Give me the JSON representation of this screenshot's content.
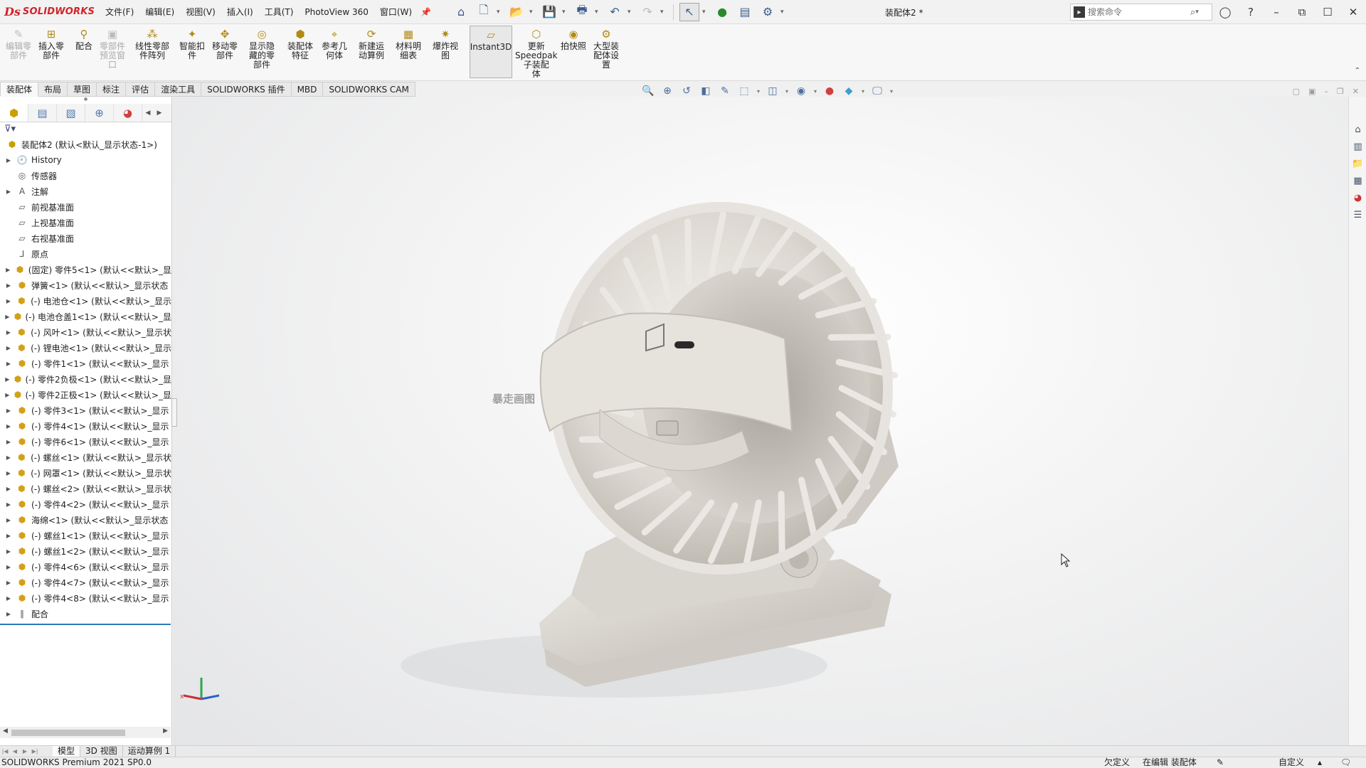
{
  "app": {
    "brand_mark": "Ds",
    "brand_text": "SOLIDWORKS",
    "doc_title": "装配体2 *"
  },
  "menu": [
    "文件(F)",
    "编辑(E)",
    "视图(V)",
    "插入(I)",
    "工具(T)",
    "PhotoView 360",
    "窗口(W)"
  ],
  "search": {
    "placeholder": "搜索命令"
  },
  "commands": [
    {
      "label": "编辑零\n部件",
      "icon": "edit-component-icon",
      "disabled": true
    },
    {
      "label": "插入零\n部件",
      "icon": "insert-component-icon"
    },
    {
      "label": "配合",
      "icon": "mate-icon"
    },
    {
      "label": "零部件\n预览窗\n口",
      "icon": "preview-window-icon",
      "disabled": true
    },
    {
      "label": "线性零部\n件阵列",
      "icon": "linear-pattern-icon"
    },
    {
      "label": "智能扣\n件",
      "icon": "smart-fastener-icon"
    },
    {
      "label": "移动零\n部件",
      "icon": "move-component-icon"
    },
    {
      "label": "显示隐\n藏的零\n部件",
      "icon": "show-hidden-icon"
    },
    {
      "label": "装配体\n特征",
      "icon": "assembly-feature-icon"
    },
    {
      "label": "参考几\n何体",
      "icon": "reference-geometry-icon"
    },
    {
      "label": "新建运\n动算例",
      "icon": "motion-study-icon"
    },
    {
      "label": "材料明\n细表",
      "icon": "bom-icon"
    },
    {
      "label": "爆炸视\n图",
      "icon": "exploded-view-icon"
    },
    {
      "label": "Instant3D",
      "icon": "instant3d-icon",
      "selected": true
    },
    {
      "label": "更新\nSpeedpak\n子装配\n体",
      "icon": "speedpak-icon"
    },
    {
      "label": "拍快照",
      "icon": "snapshot-icon"
    },
    {
      "label": "大型装\n配体设\n置",
      "icon": "large-assembly-icon"
    }
  ],
  "tabs": [
    "装配体",
    "布局",
    "草图",
    "标注",
    "评估",
    "渲染工具",
    "SOLIDWORKS 插件",
    "MBD",
    "SOLIDWORKS CAM"
  ],
  "tree": {
    "root": "装配体2  (默认<默认_显示状态-1>)",
    "items": [
      {
        "label": "History",
        "icon": "history-icon",
        "expand": true
      },
      {
        "label": "传感器",
        "icon": "sensors-icon",
        "expand": false
      },
      {
        "label": "注解",
        "icon": "annotations-icon",
        "expand": true
      },
      {
        "label": "前视基准面",
        "icon": "plane-icon",
        "expand": false
      },
      {
        "label": "上视基准面",
        "icon": "plane-icon",
        "expand": false
      },
      {
        "label": "右视基准面",
        "icon": "plane-icon",
        "expand": false
      },
      {
        "label": "原点",
        "icon": "origin-icon",
        "expand": false
      },
      {
        "label": "(固定) 零件5<1> (默认<<默认>_显",
        "icon": "part-icon",
        "expand": true
      },
      {
        "label": "弹簧<1> (默认<<默认>_显示状态",
        "icon": "part-icon",
        "expand": true
      },
      {
        "label": "(-) 电池仓<1> (默认<<默认>_显示",
        "icon": "part-icon",
        "expand": true
      },
      {
        "label": "(-) 电池仓盖1<1> (默认<<默认>_显",
        "icon": "part-icon",
        "expand": true
      },
      {
        "label": "(-) 风叶<1> (默认<<默认>_显示状",
        "icon": "part-icon",
        "expand": true
      },
      {
        "label": "(-) 锂电池<1> (默认<<默认>_显示",
        "icon": "part-icon",
        "expand": true
      },
      {
        "label": "(-) 零件1<1> (默认<<默认>_显示",
        "icon": "part-icon",
        "expand": true
      },
      {
        "label": "(-) 零件2负极<1> (默认<<默认>_显",
        "icon": "part-icon",
        "expand": true
      },
      {
        "label": "(-) 零件2正极<1> (默认<<默认>_显",
        "icon": "part-icon",
        "expand": true
      },
      {
        "label": "(-) 零件3<1> (默认<<默认>_显示",
        "icon": "part-icon",
        "expand": true
      },
      {
        "label": "(-) 零件4<1> (默认<<默认>_显示",
        "icon": "part-icon",
        "expand": true
      },
      {
        "label": "(-) 零件6<1> (默认<<默认>_显示",
        "icon": "part-icon",
        "expand": true
      },
      {
        "label": "(-) 螺丝<1> (默认<<默认>_显示状",
        "icon": "part-icon",
        "expand": true
      },
      {
        "label": "(-) 网罩<1> (默认<<默认>_显示状",
        "icon": "part-icon",
        "expand": true
      },
      {
        "label": "(-) 螺丝<2> (默认<<默认>_显示状",
        "icon": "part-icon",
        "expand": true
      },
      {
        "label": "(-) 零件4<2> (默认<<默认>_显示",
        "icon": "part-icon",
        "expand": true
      },
      {
        "label": "海绵<1> (默认<<默认>_显示状态",
        "icon": "part-icon",
        "expand": true
      },
      {
        "label": "(-) 螺丝1<1> (默认<<默认>_显示",
        "icon": "part-icon",
        "expand": true
      },
      {
        "label": "(-) 螺丝1<2> (默认<<默认>_显示",
        "icon": "part-icon",
        "expand": true
      },
      {
        "label": "(-) 零件4<6> (默认<<默认>_显示",
        "icon": "part-icon",
        "expand": true
      },
      {
        "label": "(-) 零件4<7> (默认<<默认>_显示",
        "icon": "part-icon",
        "expand": true
      },
      {
        "label": "(-) 零件4<8> (默认<<默认>_显示",
        "icon": "part-icon",
        "expand": true
      },
      {
        "label": "配合",
        "icon": "mates-folder-icon",
        "expand": true
      }
    ]
  },
  "viewport": {
    "watermark": "暴走画图"
  },
  "bottom_tabs": [
    "模型",
    "3D 视图",
    "运动算例 1"
  ],
  "status": {
    "version": "SOLIDWORKS Premium 2021 SP0.0",
    "defined": "欠定义",
    "editing": "在编辑 装配体",
    "units": "自定义"
  },
  "colors": {
    "brand": "#d2232a",
    "accent": "#2f79b9",
    "part": "#d4a017"
  }
}
